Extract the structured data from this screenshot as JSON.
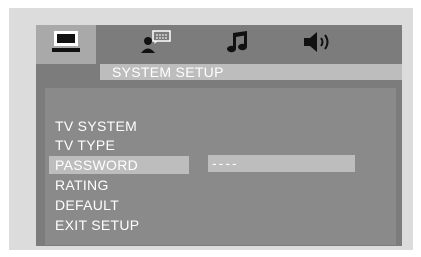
{
  "colors": {
    "frame": "#dcdcdc",
    "panel": "#7c7c7c",
    "content": "#8a8a8a",
    "highlight": "#bdbdbd",
    "text": "#ffffff"
  },
  "tabs": [
    {
      "icon": "tv-monitor-icon",
      "active": true
    },
    {
      "icon": "person-speech-icon",
      "active": false
    },
    {
      "icon": "music-note-icon",
      "active": false
    },
    {
      "icon": "speaker-icon",
      "active": false
    }
  ],
  "title": "SYSTEM SETUP",
  "menu": {
    "items": [
      {
        "label": "TV  SYSTEM",
        "selected": false
      },
      {
        "label": "TV  TYPE",
        "selected": false
      },
      {
        "label": "PASSWORD",
        "selected": true
      },
      {
        "label": "RATING",
        "selected": false
      },
      {
        "label": "DEFAULT",
        "selected": false
      }
    ],
    "exit_label": "EXIT   SETUP"
  },
  "password_field": {
    "value": "----"
  }
}
